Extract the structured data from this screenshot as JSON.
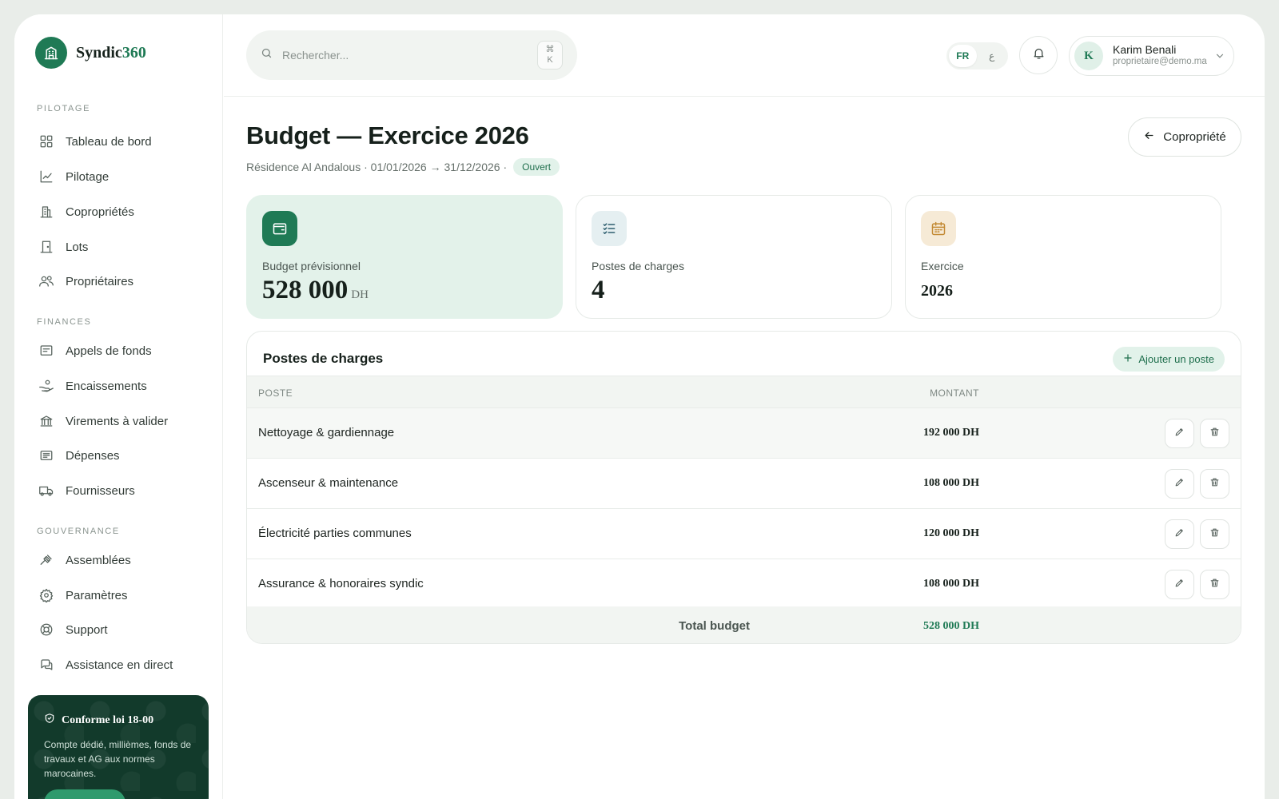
{
  "brand": {
    "name": "Syndic",
    "accent": "360"
  },
  "sidebar": {
    "sections": [
      {
        "title": "PILOTAGE",
        "items": [
          {
            "label": "Tableau de bord",
            "icon": "grid-icon"
          },
          {
            "label": "Pilotage",
            "icon": "chart-line-icon"
          },
          {
            "label": "Copropriétés",
            "icon": "building-icon"
          },
          {
            "label": "Lots",
            "icon": "door-icon"
          },
          {
            "label": "Propriétaires",
            "icon": "users-icon"
          }
        ]
      },
      {
        "title": "FINANCES",
        "items": [
          {
            "label": "Appels de fonds",
            "icon": "receipt-icon"
          },
          {
            "label": "Encaissements",
            "icon": "hand-coins-icon"
          },
          {
            "label": "Virements à valider",
            "icon": "bank-icon"
          },
          {
            "label": "Dépenses",
            "icon": "wallet-list-icon"
          },
          {
            "label": "Fournisseurs",
            "icon": "truck-icon"
          }
        ]
      },
      {
        "title": "GOUVERNANCE",
        "items": [
          {
            "label": "Assemblées",
            "icon": "gavel-icon"
          },
          {
            "label": "Paramètres",
            "icon": "gear-icon"
          },
          {
            "label": "Support",
            "icon": "lifebuoy-icon"
          },
          {
            "label": "Assistance en direct",
            "icon": "chat-icon"
          }
        ]
      }
    ],
    "promo": {
      "title": "Conforme loi 18-00",
      "text": "Compte dédié, millièmes, fonds de travaux et AG aux normes marocaines."
    }
  },
  "topbar": {
    "search_placeholder": "Rechercher...",
    "kbd_symbol": "⌘",
    "kbd_key": "K",
    "lang_active": "FR",
    "lang_other": "ع",
    "user_initial": "K",
    "user_name": "Karim Benali",
    "user_email": "proprietaire@demo.ma"
  },
  "page": {
    "title": "Budget — Exercice 2026",
    "subtitle": "Résidence Al Andalous · 01/01/2026 → 31/12/2026 ·",
    "status": "Ouvert",
    "back_label": "Copropriété"
  },
  "stats": [
    {
      "label": "Budget prévisionnel",
      "value": "528 000",
      "unit": "DH",
      "icon": "wallet-icon"
    },
    {
      "label": "Postes de charges",
      "value": "4",
      "icon": "checklist-icon"
    },
    {
      "label": "Exercice",
      "value": "2026",
      "icon": "calendar-icon"
    }
  ],
  "table": {
    "title": "Postes de charges",
    "add_label": "Ajouter un poste",
    "columns": [
      "POSTE",
      "MONTANT"
    ],
    "rows": [
      {
        "poste": "Nettoyage & gardiennage",
        "montant": "192 000 DH"
      },
      {
        "poste": "Ascenseur & maintenance",
        "montant": "108 000 DH"
      },
      {
        "poste": "Électricité parties communes",
        "montant": "120 000 DH"
      },
      {
        "poste": "Assurance & honoraires syndic",
        "montant": "108 000 DH"
      }
    ],
    "total_label": "Total budget",
    "total_value": "528 000 DH"
  },
  "colors": {
    "accent": "#1f7a55",
    "accent_soft": "#e2f2ea",
    "promo_bg": "#123a2b"
  }
}
